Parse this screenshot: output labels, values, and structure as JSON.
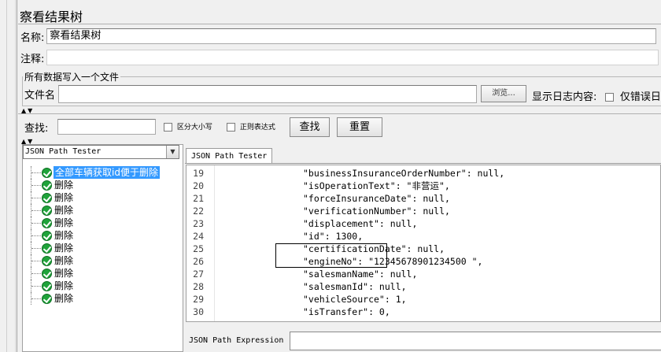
{
  "title": "察看结果树",
  "name_row": {
    "label": "名称:",
    "value": "察看结果树"
  },
  "comment_row": {
    "label": "注释:",
    "value": ""
  },
  "file_group": {
    "title": "所有数据写入一个文件",
    "filename_label": "文件名",
    "filename_value": "",
    "browse_label": "浏览...",
    "log_label": "显示日志内容:",
    "errors_only_label": "仅错误日志"
  },
  "search": {
    "label": "查找:",
    "value": "",
    "case_label": "区分大小写",
    "regex_label": "正则表达式",
    "find_button": "查找",
    "reset_button": "重置"
  },
  "tree": {
    "renderer": "JSON Path Tester",
    "items": [
      {
        "label": "全部车辆获取id便于删除",
        "selected": true
      },
      {
        "label": "删除"
      },
      {
        "label": "删除"
      },
      {
        "label": "删除"
      },
      {
        "label": "删除"
      },
      {
        "label": "删除"
      },
      {
        "label": "删除"
      },
      {
        "label": "删除"
      },
      {
        "label": "删除"
      },
      {
        "label": "删除"
      },
      {
        "label": "删除"
      }
    ]
  },
  "viewer": {
    "tab_label": "JSON Path Tester",
    "lines": [
      {
        "no": "19",
        "text": "\"businessInsuranceOrderNumber\": null,"
      },
      {
        "no": "20",
        "text": "\"isOperationText\": \"非营运\","
      },
      {
        "no": "21",
        "text": "\"forceInsuranceDate\": null,"
      },
      {
        "no": "22",
        "text": "\"verificationNumber\": null,"
      },
      {
        "no": "23",
        "text": "\"displacement\": null,"
      },
      {
        "no": "24",
        "text": "\"id\": 1300,"
      },
      {
        "no": "25",
        "text": "\"certificationDate\": null,"
      },
      {
        "no": "26",
        "text": "\"engineNo\": \"12345678901234500 \","
      },
      {
        "no": "27",
        "text": "\"salesmanName\": null,"
      },
      {
        "no": "28",
        "text": "\"salesmanId\": null,"
      },
      {
        "no": "29",
        "text": "\"vehicleSource\": 1,"
      },
      {
        "no": "30",
        "text": "\"isTransfer\": 0,"
      }
    ],
    "expression_label": "JSON Path Expression",
    "expression_value": ""
  },
  "colors": {
    "selection": "#3399ff",
    "ok_icon": "#1fa33a"
  },
  "icons": {
    "tree_status": "success-check-icon",
    "combo_arrow": "chevron-down-icon"
  }
}
